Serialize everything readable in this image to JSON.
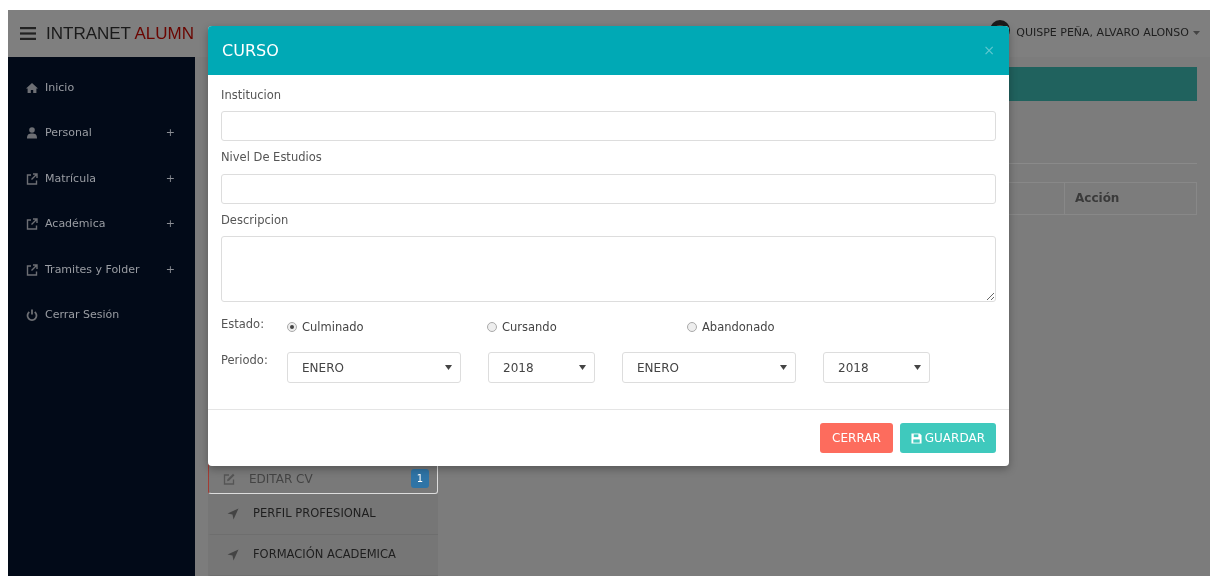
{
  "header": {
    "brand_dark": "INTRANET",
    "brand_red": "ALUMN",
    "user": "QUISPE PEÑA, ALVARO ALONSO"
  },
  "sidebar": {
    "items": [
      {
        "label": "Inicio"
      },
      {
        "label": "Personal",
        "toggle": "+"
      },
      {
        "label": "Matrícula",
        "toggle": "+"
      },
      {
        "label": "Académica",
        "toggle": "+"
      },
      {
        "label": "Tramites y Folder",
        "toggle": "+"
      },
      {
        "label": "Cerrar Sesión"
      }
    ]
  },
  "table": {
    "action_header": "Acción"
  },
  "profile_menu": [
    {
      "label": "EDITAR CV",
      "selected": true,
      "badge": "1"
    },
    {
      "label": "PERFIL PROFESIONAL",
      "selected": false
    },
    {
      "label": "FORMACIÓN ACADEMICA",
      "selected": false
    }
  ],
  "modal": {
    "title": "CURSO",
    "close": "×",
    "fields": [
      {
        "label": "Institucion",
        "kind": "input"
      },
      {
        "label": "Nivel De Estudios",
        "kind": "input"
      },
      {
        "label": "Descripcion",
        "kind": "textarea"
      }
    ],
    "estado": {
      "label": "Estado:",
      "options": [
        {
          "label": "Culminado",
          "selected": true
        },
        {
          "label": "Cursando",
          "selected": false
        },
        {
          "label": "Abandonado",
          "selected": false
        }
      ]
    },
    "periodo": {
      "label": "Periodo:",
      "selects": [
        {
          "value": "ENERO",
          "kind": "month"
        },
        {
          "value": "2018",
          "kind": "year"
        },
        {
          "value": "ENERO",
          "kind": "month"
        },
        {
          "value": "2018",
          "kind": "year"
        }
      ]
    },
    "buttons": [
      {
        "label": "CERRAR",
        "kind": "close"
      },
      {
        "label": "GUARDAR",
        "kind": "save"
      }
    ]
  }
}
